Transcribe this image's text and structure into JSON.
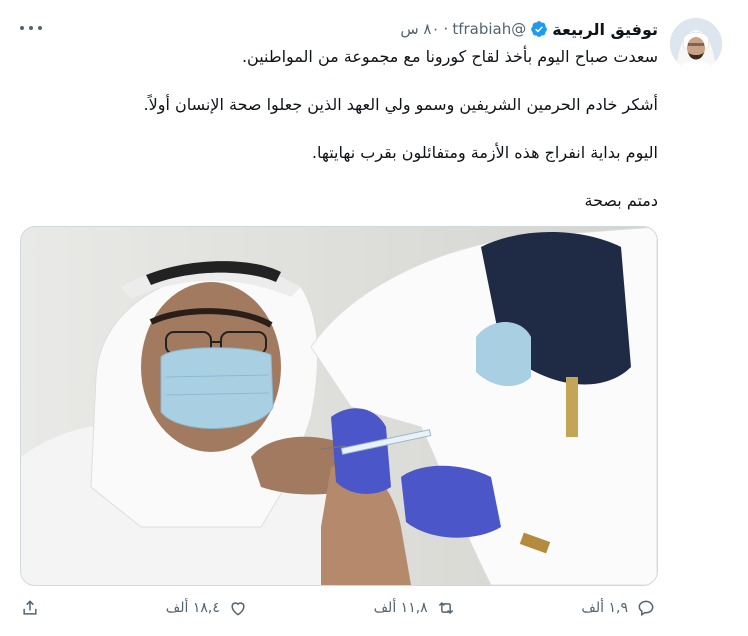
{
  "tweet": {
    "author_name": "توفيق الربيعة",
    "handle": "@tfrabiah",
    "time": "٨٠ س",
    "separator": "·",
    "paragraphs": [
      "سعدت صباح اليوم بأخذ لقاح كورونا مع مجموعة من المواطنين.",
      "أشكر خادم الحرمين الشريفين وسمو ولي العهد الذين جعلوا صحة الإنسان أولاً.",
      "اليوم بداية انفراج هذه الأزمة ومتفائلون بقرب نهايتها.",
      "دمتم بصحة"
    ],
    "counts": {
      "replies": "١,٩ ألف",
      "retweets": "١١,٨ ألف",
      "likes": "١٨,٤ ألف"
    }
  },
  "icons": {
    "verified": "verified-badge-icon",
    "more": "more-icon",
    "reply": "reply-icon",
    "retweet": "retweet-icon",
    "like": "heart-icon",
    "share": "share-icon"
  },
  "colors": {
    "accent": "#1d9bf0",
    "text": "#0f1419",
    "muted": "#536471"
  }
}
